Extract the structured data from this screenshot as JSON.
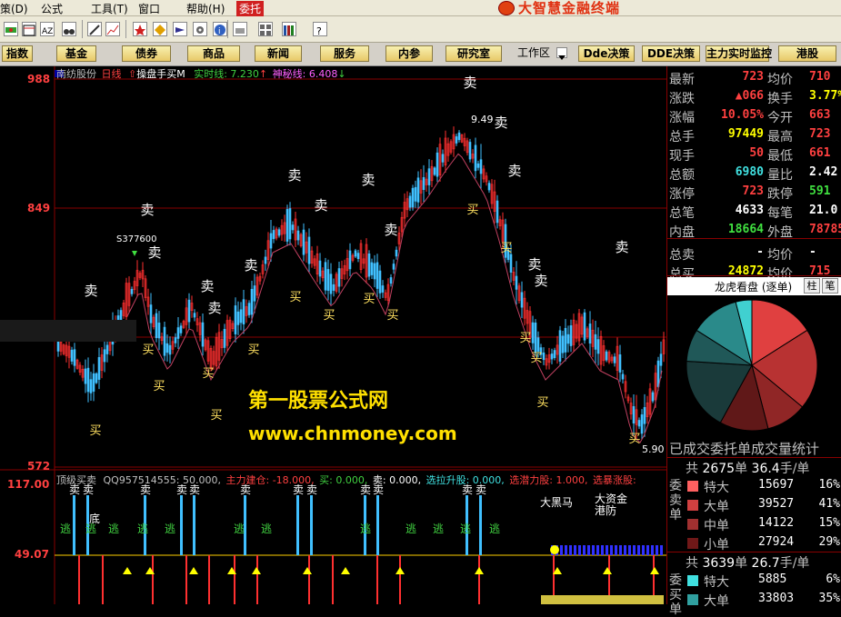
{
  "menu": {
    "items": [
      "策(D)",
      "公式",
      "工具(T)",
      "窗口",
      "帮助(H)",
      "委托"
    ],
    "brand": "大智慧金融终端"
  },
  "nav": {
    "buttons": [
      "指数",
      "基金",
      "债券",
      "商品",
      "新闻",
      "服务",
      "内参",
      "研究室"
    ],
    "workspace": "工作区",
    "right_buttons": [
      "Dde决策",
      "DDE决策",
      "主力实时监控",
      "港股"
    ]
  },
  "chart": {
    "stock_name": "南纺股份",
    "period": "日线",
    "indicator": "操盘手买M",
    "realtime_label": "实时线: 7.230",
    "shenmi_label": "神秘线: 6.408",
    "y_ticks": [
      "988",
      "849",
      "572"
    ],
    "high_label": "9.49",
    "low_label": "5.90",
    "s_label": "S377600",
    "sell_label": "卖",
    "buy_label": "买",
    "sell_marks": [
      [
        100,
        325
      ],
      [
        162,
        236
      ],
      [
        170,
        283
      ],
      [
        228,
        320
      ],
      [
        236,
        344
      ],
      [
        276,
        297
      ],
      [
        324,
        198
      ],
      [
        353,
        231
      ],
      [
        405,
        203
      ],
      [
        430,
        258
      ],
      [
        517,
        96
      ],
      [
        551,
        140
      ],
      [
        566,
        193
      ],
      [
        588,
        296
      ],
      [
        595,
        314
      ],
      [
        684,
        277
      ]
    ],
    "buy_marks": [
      [
        105,
        478
      ],
      [
        163,
        389
      ],
      [
        175,
        429
      ],
      [
        229,
        415
      ],
      [
        238,
        461
      ],
      [
        279,
        389
      ],
      [
        325,
        331
      ],
      [
        362,
        351
      ],
      [
        406,
        333
      ],
      [
        432,
        351
      ],
      [
        520,
        235
      ],
      [
        557,
        277
      ],
      [
        578,
        376
      ],
      [
        590,
        398
      ],
      [
        597,
        447
      ],
      [
        698,
        487
      ]
    ]
  },
  "watermark": {
    "line1": "第一股票公式网",
    "line2": "www.chnmoney.com"
  },
  "indicator": {
    "title": "顶级买卖",
    "params": "QQ957514555: 50.000,",
    "zhuli": "主力建仓: -18.000,",
    "mai": "买: 0.000,",
    "mai2": "卖: 0.000,",
    "xuanla": "选拉升股: 0.000,",
    "xuanqian": "选潜力股: 1.000,",
    "xuanzhang": "选暴涨股:",
    "y_ticks": [
      "117.00",
      "49.07"
    ],
    "tag_dahei": "大黑马",
    "tag_dazijin": "大资金",
    "tag_gangbi": "港防",
    "tag_di": "底",
    "tag_taoxx": "逃",
    "sell_tag": "卖",
    "sell_xs": [
      82,
      97,
      160,
      200,
      214,
      270,
      328,
      343,
      402,
      416,
      514,
      529
    ],
    "tao_xs": [
      72,
      100,
      125,
      157,
      187,
      263,
      293,
      402,
      452,
      482,
      512,
      544
    ]
  },
  "quote": {
    "rows": [
      {
        "k1": "最新",
        "v1": "723",
        "c1": "#ff4040",
        "k2": "均价",
        "v2": "710",
        "c2": "#ff4040"
      },
      {
        "k1": "涨跌",
        "v1": "▲066",
        "c1": "#ff4040",
        "k2": "换手",
        "v2": "3.77%",
        "c2": "#ffff00"
      },
      {
        "k1": "涨幅",
        "v1": "10.05%",
        "c1": "#ff4040",
        "k2": "今开",
        "v2": "663",
        "c2": "#ff4040"
      },
      {
        "k1": "总手",
        "v1": "97449",
        "c1": "#ffff00",
        "k2": "最高",
        "v2": "723",
        "c2": "#ff4040"
      },
      {
        "k1": "现手",
        "v1": "50",
        "c1": "#ff4040",
        "k2": "最低",
        "v2": "661",
        "c2": "#ff4040"
      },
      {
        "k1": "总额",
        "v1": "6980",
        "c1": "#40e0e0",
        "k2": "量比",
        "v2": "2.42",
        "c2": "#ffffff"
      },
      {
        "k1": "涨停",
        "v1": "723",
        "c1": "#ff4040",
        "k2": "跌停",
        "v2": "591",
        "c2": "#40e040"
      },
      {
        "k1": "总笔",
        "v1": "4633",
        "c1": "#ffffff",
        "k2": "每笔",
        "v2": "21.0",
        "c2": "#ffffff"
      },
      {
        "k1": "内盘",
        "v1": "18664",
        "c1": "#40e040",
        "k2": "外盘",
        "v2": "78785",
        "c2": "#ff4040"
      },
      {
        "k1": "总卖",
        "v1": "-",
        "c1": "#ffffff",
        "k2": "均价",
        "v2": "-",
        "c2": "#ffffff"
      },
      {
        "k1": "总买",
        "v1": "24872",
        "c1": "#ffff00",
        "k2": "均价",
        "v2": "715",
        "c2": "#ff4040"
      }
    ],
    "longhu_title": "龙虎看盘 (逐单)",
    "btn_zhu": "柱",
    "btn_bi": "笔"
  },
  "pie": {
    "slices": [
      {
        "value": 16,
        "color": "#e04040"
      },
      {
        "value": 20,
        "color": "#b83232"
      },
      {
        "value": 10,
        "color": "#902626"
      },
      {
        "value": 12,
        "color": "#601818"
      },
      {
        "value": 18,
        "color": "#1a3a3a"
      },
      {
        "value": 8,
        "color": "#205858"
      },
      {
        "value": 12,
        "color": "#2a8a8a"
      },
      {
        "value": 4,
        "color": "#40d0d0"
      }
    ]
  },
  "stats": {
    "title": "已成交委托单成交量统计",
    "sell": {
      "side": "委卖单",
      "count": "2675",
      "count_unit": "单",
      "avg": "36.4",
      "avg_unit": "手/单",
      "rows": [
        {
          "label": "特大",
          "value": "15697",
          "pct": "16%",
          "color": "#ff6060"
        },
        {
          "label": "大单",
          "value": "39527",
          "pct": "41%",
          "color": "#d04040"
        },
        {
          "label": "中单",
          "value": "14122",
          "pct": "15%",
          "color": "#a03030"
        },
        {
          "label": "小单",
          "value": "27924",
          "pct": "29%",
          "color": "#701818"
        }
      ]
    },
    "buy": {
      "side": "委买单",
      "count": "3639",
      "count_unit": "单",
      "avg": "26.7",
      "avg_unit": "手/单",
      "rows": [
        {
          "label": "特大",
          "value": "5885",
          "pct": "6%",
          "color": "#40e0e0"
        },
        {
          "label": "大单",
          "value": "33803",
          "pct": "35%",
          "color": "#30a0a0"
        }
      ]
    }
  }
}
